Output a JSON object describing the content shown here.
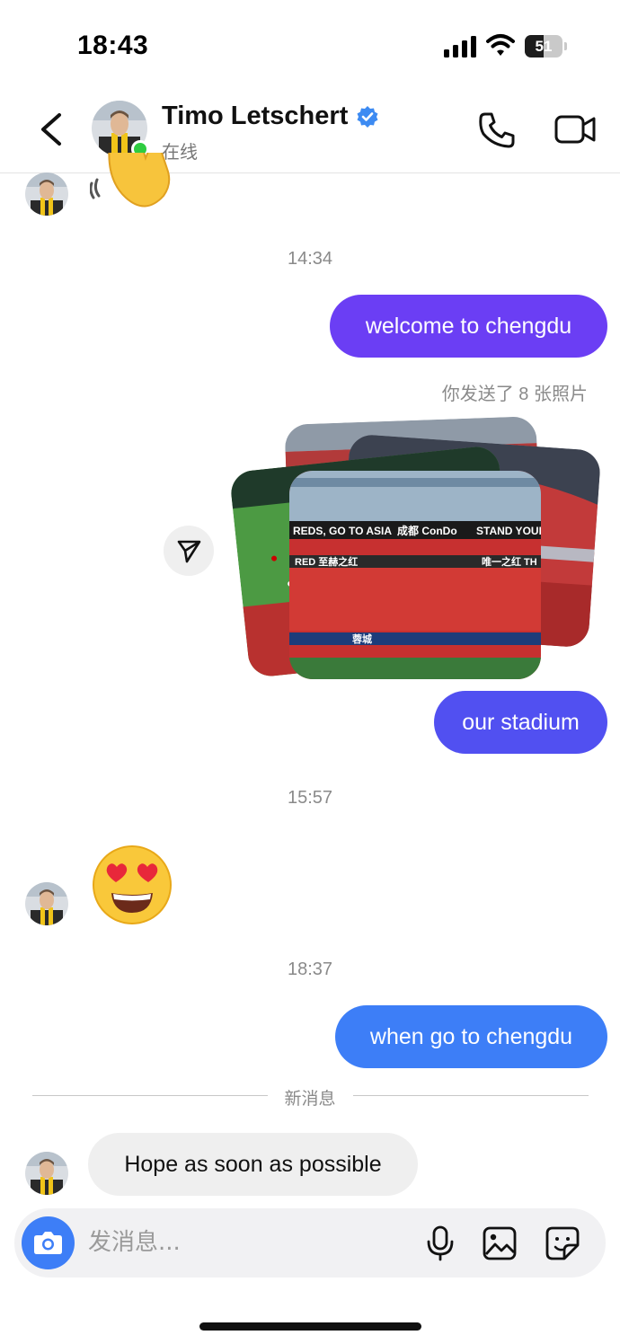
{
  "status_bar": {
    "time": "18:43",
    "battery": "51",
    "battery_level": 0.51
  },
  "header": {
    "name": "Timo Letschert",
    "status": "在线",
    "icons": [
      "chevron-left-icon",
      "verified-badge-icon",
      "phone-icon",
      "video-camera-icon"
    ]
  },
  "messages": {
    "timestamp_1": "14:34",
    "sent_1": "welcome to chengdu",
    "photos_note": "你发送了 8 张照片",
    "sent_2": "our stadium",
    "timestamp_2": "15:57",
    "timestamp_3": "18:37",
    "sent_3": "when go to chengdu",
    "new_messages_divider": "新消息",
    "received_1": "Hope as soon as possible",
    "emoji": [
      "waving-hand",
      "heart-eyes-face"
    ]
  },
  "photo_banners": {
    "banner_left": "REDS, GO TO ASIA",
    "banner_mid": "成都 ConDo",
    "banner_right": "STAND YOUR",
    "banner_lower_left": "RED 至赫之红",
    "banner_lower_right": "唯一之红 TH",
    "banner_bottom": "蓉城"
  },
  "composer": {
    "placeholder": "发消息..."
  },
  "colors": {
    "bubble_1": "#6b3ef4",
    "bubble_2": "#5150f1",
    "bubble_3": "#3d7ef7",
    "online": "#2ecc40",
    "verified": "#3d8bf2"
  }
}
